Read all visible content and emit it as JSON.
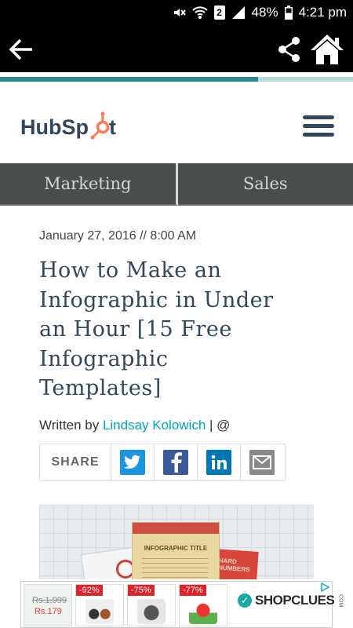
{
  "status_bar": {
    "battery": "48%",
    "time": "4:21 pm",
    "sim_slot": "2",
    "icons": [
      "mute-icon",
      "wifi-icon",
      "sim-icon",
      "signal-icon",
      "battery-icon"
    ]
  },
  "toolbar": {
    "back_icon": "back-arrow-icon",
    "share_icon": "share-icon",
    "home_icon": "home-icon"
  },
  "reading_progress": 0.73,
  "header": {
    "logo_text": "HubSpot",
    "menu_icon": "hamburger-menu-icon"
  },
  "nav_tabs": [
    {
      "label": "Marketing"
    },
    {
      "label": "Sales"
    }
  ],
  "article": {
    "date": "January 27, 2016 // 8:00 AM",
    "title_lines": [
      "How to Make an",
      "Infographic in Under",
      "an Hour [15 Free",
      "Infographic",
      "Templates]"
    ],
    "byline_prefix": "Written by ",
    "author": "Lindsay Kolowich",
    "byline_suffix": " | @",
    "share_label": "SHARE",
    "share_buttons": [
      {
        "name": "twitter",
        "color": "#1b95e0"
      },
      {
        "name": "facebook",
        "color": "#3b5998"
      },
      {
        "name": "linkedin",
        "color": "#0077b5"
      },
      {
        "name": "email",
        "color": "#888888"
      }
    ],
    "infographic": {
      "title": "INFOGRAPHIC TITLE",
      "side_text": "HARD NUMBERS"
    }
  },
  "ad": {
    "old_price": "Rs.1,999",
    "new_price": "Rs.179",
    "discounts": [
      "-92%",
      "-75%",
      "-77%"
    ],
    "brand": "SHOPCLUES",
    "brand_suffix": "COM"
  },
  "colors": {
    "hubspot_orange": "#ff7a59",
    "hubspot_navy": "#33475b",
    "accent_teal": "#00a4bd",
    "nav_bg": "#4a4d4e"
  }
}
